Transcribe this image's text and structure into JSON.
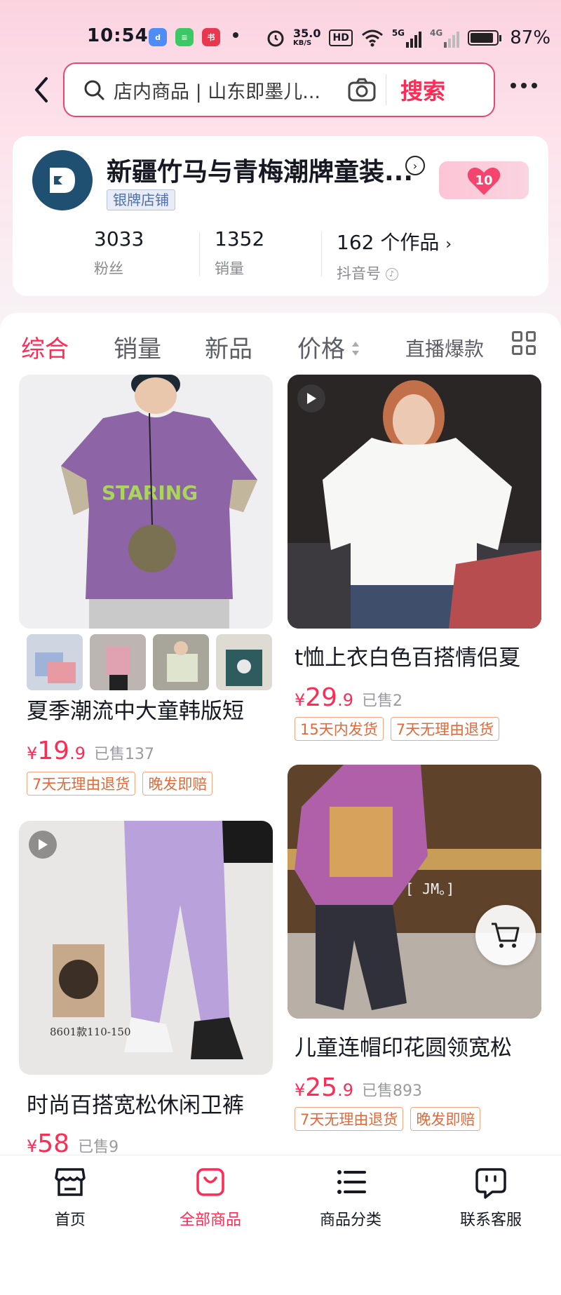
{
  "status_bar": {
    "time": "10:54",
    "net_speed": "35.0",
    "net_unit": "KB/S",
    "hd": "HD",
    "sig1": "5G",
    "sig2": "4G",
    "battery": "87%"
  },
  "search": {
    "placeholder": "店内商品 | 山东即墨儿...",
    "button": "搜索"
  },
  "shop": {
    "name": "新疆竹马与青梅潮牌童装...",
    "badge": "银牌店铺",
    "fan_level": "10",
    "stats": [
      {
        "value": "3033",
        "label": "粉丝"
      },
      {
        "value": "1352",
        "label": "销量"
      },
      {
        "value": "162 个作品",
        "label": "抖音号"
      }
    ]
  },
  "tabs": [
    "综合",
    "销量",
    "新品",
    "价格",
    "直播爆款"
  ],
  "products": [
    {
      "title": "夏季潮流中大童韩版短",
      "currency": "¥",
      "price_int": "19",
      "price_dec": ".9",
      "sold": "已售137",
      "tags": [
        "7天无理由退货",
        "晚发即赔"
      ]
    },
    {
      "title": "t恤上衣白色百搭情侣夏",
      "currency": "¥",
      "price_int": "29",
      "price_dec": ".9",
      "sold": "已售2",
      "tags": [
        "15天内发货",
        "7天无理由退货"
      ]
    },
    {
      "title": "时尚百搭宽松休闲卫裤",
      "currency": "¥",
      "price_int": "58",
      "price_dec": "",
      "sold": "已售9",
      "tags": [],
      "img_text": "8601款110-150"
    },
    {
      "title": "儿童连帽印花圆领宽松",
      "currency": "¥",
      "price_int": "25",
      "price_dec": ".9",
      "sold": "已售893",
      "tags": [
        "7天无理由退货",
        "晚发即赔"
      ],
      "img_text": "[ JM。]"
    }
  ],
  "print_text": "STARING",
  "bottom_nav": [
    {
      "label": "首页",
      "icon": "store-icon"
    },
    {
      "label": "全部商品",
      "icon": "bag-icon"
    },
    {
      "label": "商品分类",
      "icon": "list-icon"
    },
    {
      "label": "联系客服",
      "icon": "chat-icon"
    }
  ],
  "colors": {
    "accent": "#fe2c55",
    "tag": "#e06a3a",
    "badge": "#5070a8"
  }
}
